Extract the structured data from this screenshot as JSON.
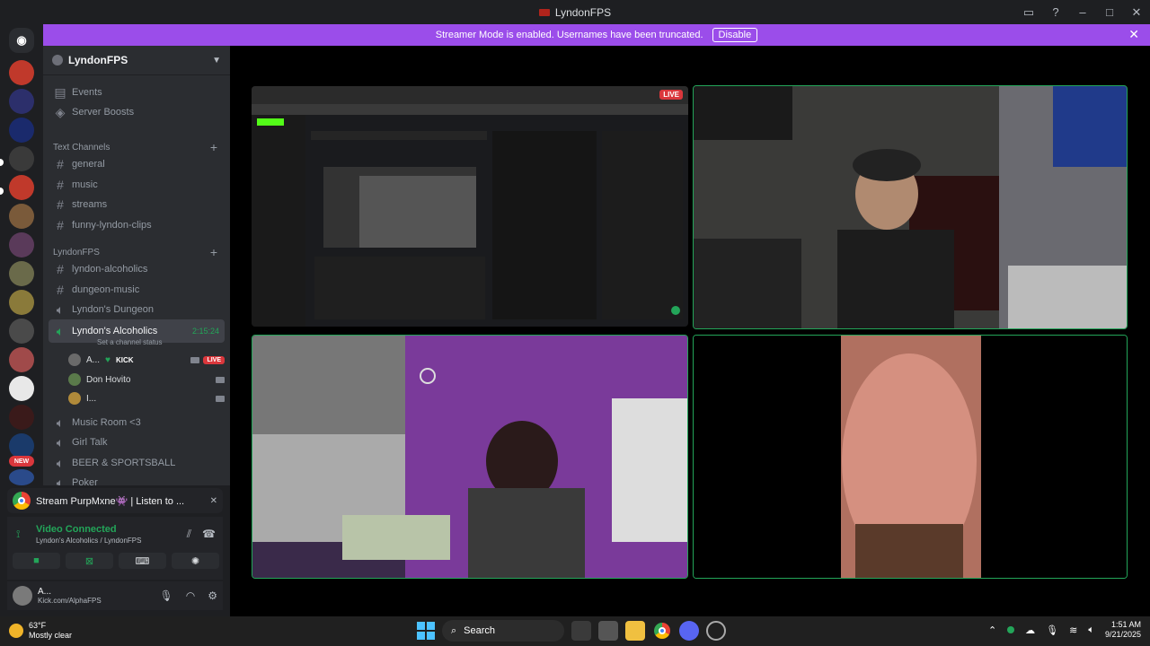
{
  "window": {
    "title": "LyndonFPS"
  },
  "banner": {
    "text": "Streamer Mode is enabled. Usernames have been truncated.",
    "disable_label": "Disable"
  },
  "guild": {
    "name": "LyndonFPS"
  },
  "sidebar": {
    "top_items": [
      {
        "label": "Events"
      },
      {
        "label": "Server Boosts"
      }
    ],
    "text_category": "Text Channels",
    "text_channels": [
      {
        "label": "general"
      },
      {
        "label": "music"
      },
      {
        "label": "streams"
      },
      {
        "label": "funny-lyndon-clips"
      }
    ],
    "lyndon_category": "LyndonFPS",
    "lyndon_channels": [
      {
        "label": "lyndon-alcoholics"
      },
      {
        "label": "dungeon-music"
      }
    ],
    "voice_dungeon": "Lyndon's Dungeon",
    "active_voice": {
      "label": "Lyndon's Alcoholics",
      "timer": "2:15:24",
      "status": "Set a channel status"
    },
    "voice_users": [
      {
        "name": "A...",
        "tag": "KICK",
        "live": "LIVE"
      },
      {
        "name": "Don Hovito"
      },
      {
        "name": "I..."
      }
    ],
    "more_voice": [
      {
        "label": "Music Room <3"
      },
      {
        "label": "Girl Talk"
      },
      {
        "label": "BEER & SPORTSBALL"
      },
      {
        "label": "Poker"
      }
    ]
  },
  "servers": {
    "new_badge": "NEW"
  },
  "activity": {
    "text": "Stream PurpMxne👾 | Listen to ..."
  },
  "voice_panel": {
    "status": "Video Connected",
    "location": "Lyndon's Alcoholics / LyndonFPS"
  },
  "user": {
    "name": "A...",
    "status": "Kick.com/AlphaFPS"
  },
  "stage": {
    "live_label": "LIVE"
  },
  "taskbar": {
    "temp": "63°F",
    "weather": "Mostly clear",
    "search": "Search",
    "time": "1:51 AM",
    "date": "9/21/2025"
  },
  "colors": {
    "accent": "#9b4dea",
    "green": "#23a559",
    "red": "#da373c"
  }
}
